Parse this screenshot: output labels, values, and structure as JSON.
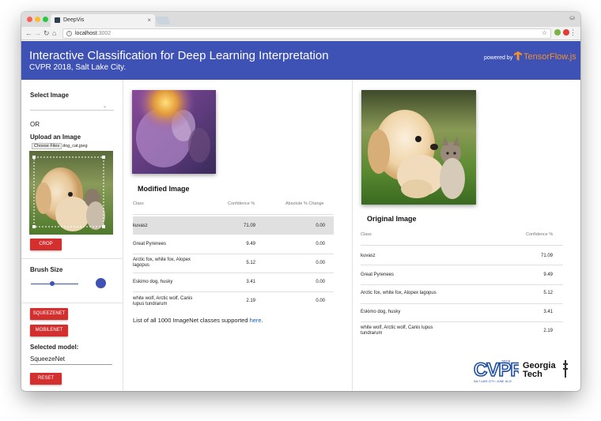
{
  "browser": {
    "tab_title": "DeepVis",
    "tab_close": "×",
    "url_host": "localhost",
    "url_port": ":3002"
  },
  "header": {
    "title": "Interactive Classification for Deep Learning Interpretation",
    "subtitle": "CVPR 2018, Salt Lake City.",
    "powered_by": "powered by",
    "brand": "TensorFlow",
    "brand_suffix": ".js"
  },
  "sidebar": {
    "select_image_label": "Select Image",
    "or_text": "OR",
    "upload_label": "Upload an Image",
    "choose_files": "Choose Files",
    "file_name": "dog_cat.jpeg",
    "crop_button": "CROP",
    "brush_size_label": "Brush Size",
    "brush_size": 0.45,
    "squeezenet_button": "SQUEEZENET",
    "mobilenet_button": "MOBILENET",
    "selected_model_label": "Selected model:",
    "selected_model_value": "SqueezeNet",
    "reset_button": "RESET"
  },
  "modified": {
    "title": "Modified Image",
    "headers": [
      "Class",
      "Confidence %",
      "Absolute % Change"
    ],
    "rows": [
      {
        "cls": "kuvasz",
        "conf": "71.09",
        "change": "0.00",
        "highlight": true
      },
      {
        "cls": "Great Pyrenees",
        "conf": "9.49",
        "change": "0.00"
      },
      {
        "cls": "Arctic fox, white fox, Alopex lagopus",
        "conf": "5.12",
        "change": "0.00"
      },
      {
        "cls": "Eskimo dog, husky",
        "conf": "3.41",
        "change": "0.00"
      },
      {
        "cls": "white wolf, Arctic wolf, Canis lupus tundrarum",
        "conf": "2.19",
        "change": "0.00"
      }
    ],
    "footer_prefix": "List of all 1000 ImageNet classes supported",
    "footer_link": "here",
    "footer_suffix": "."
  },
  "original": {
    "title": "Original Image",
    "headers": [
      "Class",
      "Confidence %"
    ],
    "rows": [
      {
        "cls": "kuvasz",
        "conf": "71.09"
      },
      {
        "cls": "Great Pyrenees",
        "conf": "9.49"
      },
      {
        "cls": "Arctic fox, white fox, Alopex lagopus",
        "conf": "5.12"
      },
      {
        "cls": "Eskimo dog, husky",
        "conf": "3.41"
      },
      {
        "cls": "white wolf, Arctic wolf, Canis lupus tundrarum",
        "conf": "2.19"
      }
    ]
  },
  "logos": {
    "cvpr": "CVPR",
    "cvpr_year": "2018",
    "cvpr_location": "SALT LAKE CITY • JUNE 18-22",
    "gt_line1": "Georgia",
    "gt_line2": "Tech"
  },
  "colors": {
    "header": "#3e51b5",
    "accent_red": "#d32f2f",
    "tensorflow_orange": "#f2912c",
    "link": "#1a5fb4"
  },
  "icons": [
    "back-icon",
    "forward-icon",
    "reload-icon",
    "home-icon",
    "info-icon",
    "star-icon",
    "extension-icon",
    "menu-icon",
    "tensorflow-icon"
  ]
}
